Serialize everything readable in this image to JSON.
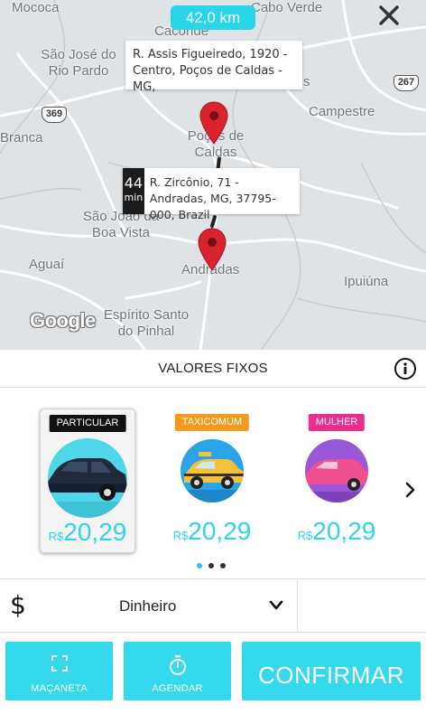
{
  "map": {
    "distance": "42,0 km",
    "origin_address": "R. Assis Figueiredo, 1920 - Centro, Poços de Caldas - MG,",
    "destination_address": "R. Zircônio, 71 - Andradas, MG, 37795-000, Brazil",
    "eta_value": "44",
    "eta_unit": "min",
    "attribution": "Google",
    "cities": {
      "mococa": "Mococa",
      "cabo_verde": "Cabo Verde",
      "caconde": "Caconde",
      "sao_jose_line1": "São José do",
      "sao_jose_line2": "Rio Pardo",
      "branca": "Branca",
      "pocos_line1": "Poços de",
      "pocos_line2": "Caldas",
      "campestre": "Campestre",
      "sao_joao_line1": "São João da",
      "sao_joao_line2": "Boa Vista",
      "aguai": "Aguaí",
      "andradas": "Andradas",
      "ipuiuna": "Ipuiúna",
      "espirito_line1": "Espírito Santo",
      "espirito_line2": "do Pinhal",
      "s_frag": "s"
    },
    "shields": {
      "a": "369",
      "b": "267"
    },
    "icons": {
      "close": "close-icon",
      "pin": "map-pin-icon"
    }
  },
  "panel": {
    "title": "VALORES FIXOS",
    "info_icon": "info-icon"
  },
  "cars": [
    {
      "badge": "PARTICULAR",
      "badge_color": "#111111",
      "currency": "R$",
      "price": "20,29",
      "selected": true,
      "circle_color": "#4fd6ea",
      "car_color": "#1f2a3a"
    },
    {
      "badge": "TAXICOMUM",
      "badge_color": "#f39b1f",
      "currency": "R$",
      "price": "20,29",
      "selected": false,
      "circle_color": "#2aa3e8",
      "car_color": "#f4c23a"
    },
    {
      "badge": "MULHER",
      "badge_color": "#ea2d8f",
      "currency": "R$",
      "price": "20,29",
      "selected": false,
      "circle_color": "#9a58d8",
      "car_color": "#ef4f8e"
    }
  ],
  "carousel": {
    "pages": 3,
    "active_page": 0
  },
  "payment": {
    "symbol": "$",
    "method": "Dinheiro"
  },
  "actions": {
    "macaneta": "MAÇANETA",
    "agendar": "AGENDAR",
    "confirmar": "CONFIRMAR"
  },
  "colors": {
    "accent": "#34d9ee",
    "price": "#2fd3ea",
    "pin": "#d9232e"
  }
}
